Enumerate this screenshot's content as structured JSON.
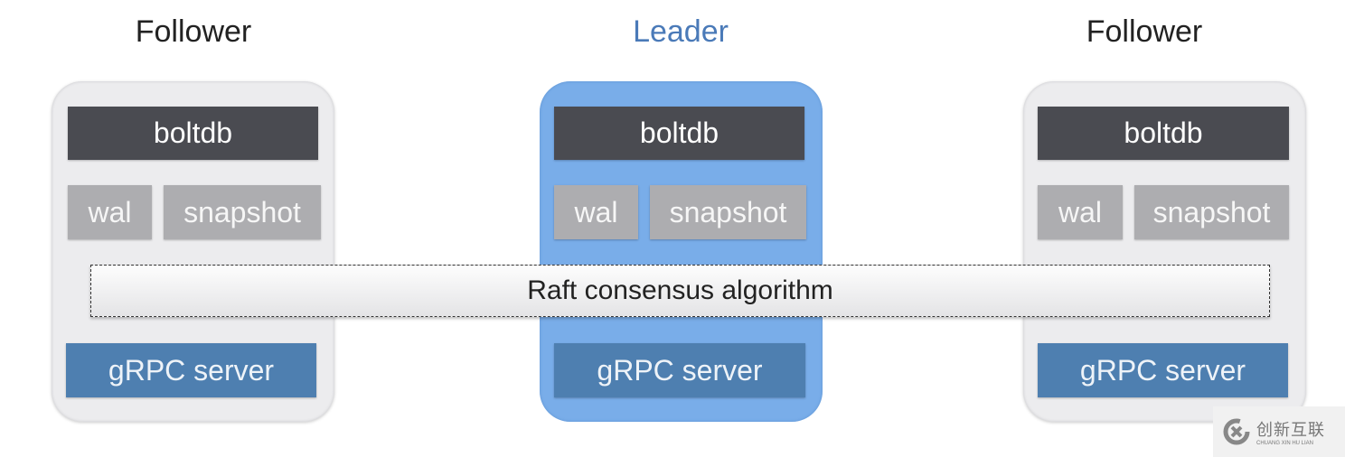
{
  "nodes": [
    {
      "role": "Follower",
      "db": "boltdb",
      "wal": "wal",
      "snapshot": "snapshot",
      "server": "gRPC server"
    },
    {
      "role": "Leader",
      "db": "boltdb",
      "wal": "wal",
      "snapshot": "snapshot",
      "server": "gRPC server"
    },
    {
      "role": "Follower",
      "db": "boltdb",
      "wal": "wal",
      "snapshot": "snapshot",
      "server": "gRPC server"
    }
  ],
  "consensus": "Raft consensus algorithm",
  "watermark": {
    "text": "创新互联",
    "sub": "CHUANG XIN HU LIAN"
  },
  "colors": {
    "leader": "#79ade9",
    "leader_title": "#4a7ab8",
    "follower": "#ececee",
    "boltdb": "#4a4b51",
    "storage": "#adadb0",
    "grpc": "#4e7fb0"
  }
}
